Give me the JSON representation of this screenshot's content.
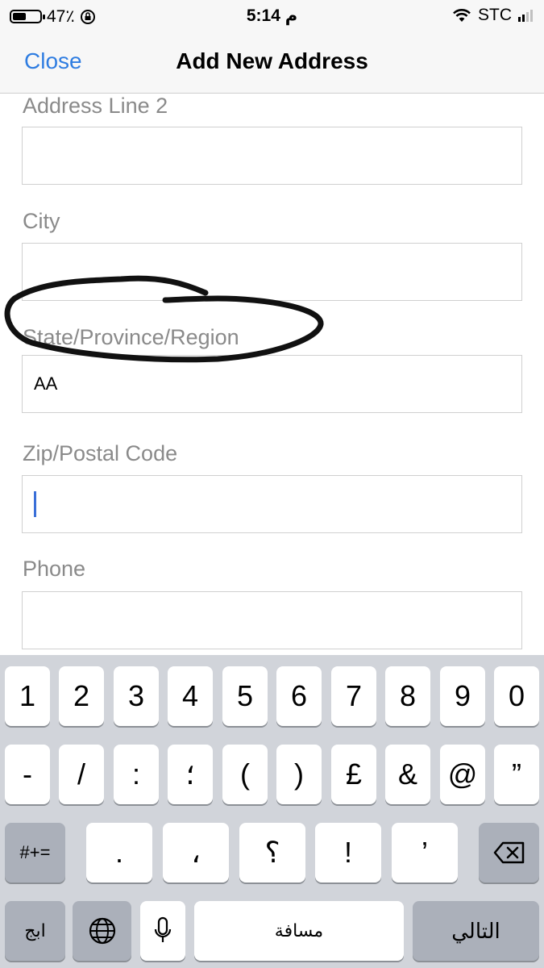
{
  "status_bar": {
    "battery_percent": "47٪",
    "battery_level": 0.47,
    "time": "5:14 م",
    "carrier": "STC"
  },
  "nav": {
    "close_label": "Close",
    "title": "Add New Address"
  },
  "form": {
    "address_line2": {
      "label": "Address Line 2",
      "value": ""
    },
    "city": {
      "label": "City",
      "value": ""
    },
    "state": {
      "label": "State/Province/Region",
      "value": "AA"
    },
    "zip": {
      "label": "Zip/Postal Code",
      "value": ""
    },
    "phone": {
      "label": "Phone",
      "value": ""
    }
  },
  "keyboard": {
    "row1": [
      "1",
      "2",
      "3",
      "4",
      "5",
      "6",
      "7",
      "8",
      "9",
      "0"
    ],
    "row2": [
      "-",
      "/",
      ":",
      "؛",
      "(",
      ")",
      "£",
      "&",
      "@",
      "”"
    ],
    "row3": [
      "#+=",
      ".",
      "،",
      "؟",
      "!",
      "’"
    ],
    "lang_label": "ابج",
    "space_label": "مسافة",
    "next_label": "التالي"
  }
}
